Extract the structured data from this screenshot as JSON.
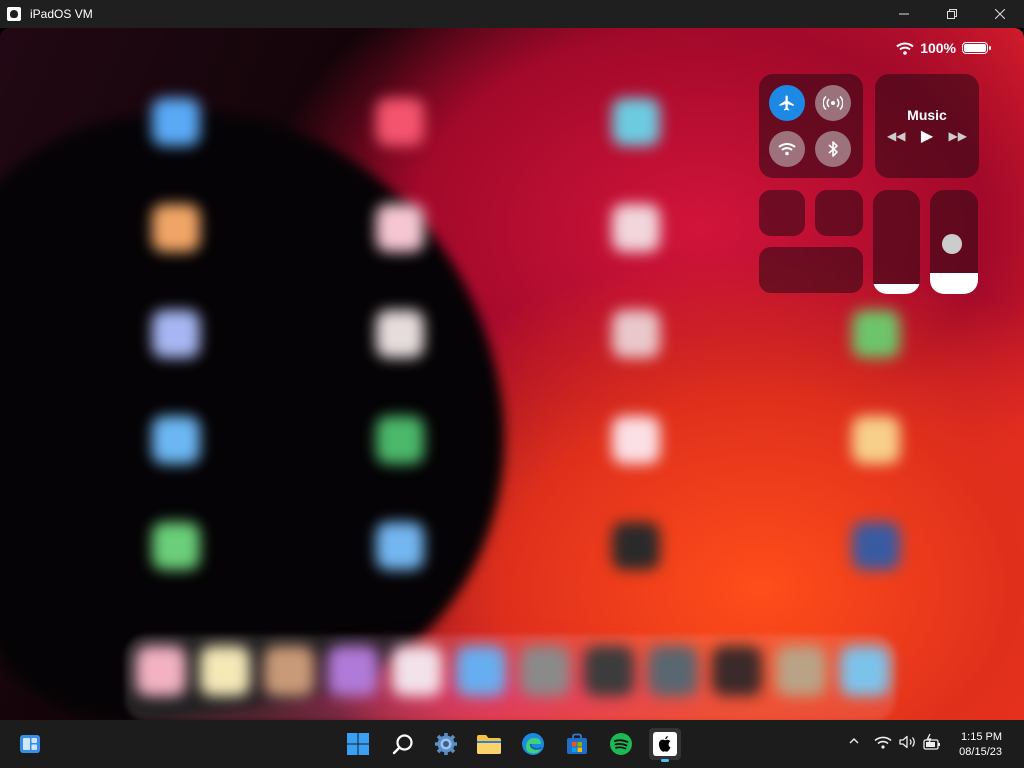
{
  "window": {
    "title": "iPadOS VM"
  },
  "status_bar": {
    "battery_text": "100%"
  },
  "control_center": {
    "airplane_mode": true,
    "music": {
      "title": "Music"
    }
  },
  "taskbar": {
    "apps": [
      {
        "name": "start-icon"
      },
      {
        "name": "search-icon"
      },
      {
        "name": "settings-icon"
      },
      {
        "name": "file-explorer-icon"
      },
      {
        "name": "edge-icon"
      },
      {
        "name": "store-icon"
      },
      {
        "name": "spotify-icon"
      },
      {
        "name": "apple-icon"
      }
    ],
    "clock": {
      "time": "1:15 PM",
      "date": "08/15/23"
    }
  },
  "colors": {
    "accent_blue": "#1e88e5",
    "taskbar_bg": "#1c1c1c",
    "titlebar_bg": "#1f1f1f",
    "spotify_green": "#1db954"
  }
}
